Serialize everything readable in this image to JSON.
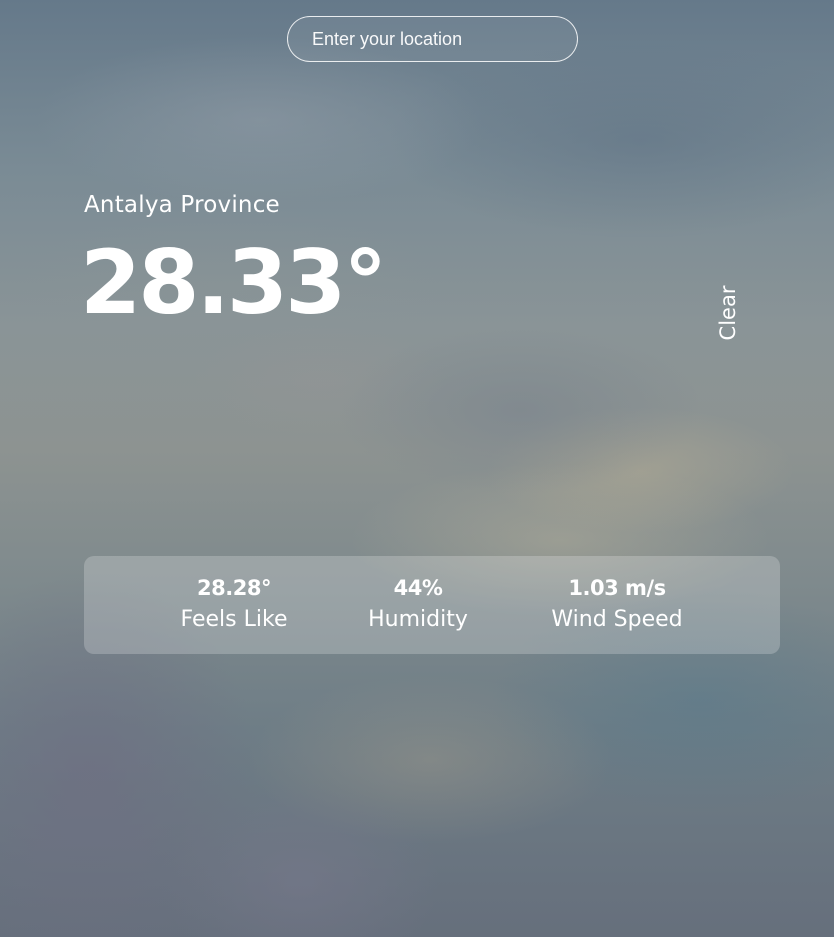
{
  "search": {
    "placeholder": "Enter your location",
    "value": ""
  },
  "weather": {
    "location": "Antalya Province",
    "temperature": "28.33°",
    "condition": "Clear"
  },
  "stats": [
    {
      "value": "28.28°",
      "label": "Feels Like"
    },
    {
      "value": "44%",
      "label": "Humidity"
    },
    {
      "value": "1.03 m/s",
      "label": "Wind Speed"
    }
  ],
  "theme": {
    "text_color": "#ffffff",
    "panel_color": "rgba(255,255,255,0.22)"
  }
}
